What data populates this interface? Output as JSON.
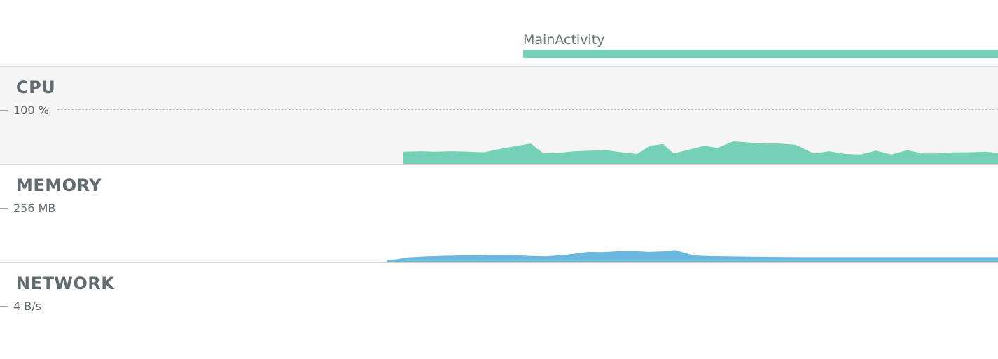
{
  "timeline": {
    "activity_label": "MainActivity",
    "activity_color": "#74d1b5"
  },
  "monitors": {
    "cpu": {
      "title": "CPU",
      "axis_max_label": "100 %",
      "color": "#74d1b5",
      "unit": "%",
      "samples": [
        [
          0.0,
          0
        ],
        [
          0.0,
          22
        ],
        [
          0.07,
          23
        ],
        [
          0.12,
          22
        ],
        [
          0.19,
          23
        ],
        [
          0.25,
          22
        ],
        [
          0.31,
          21
        ],
        [
          0.37,
          27
        ],
        [
          0.43,
          32
        ],
        [
          0.49,
          37
        ],
        [
          0.54,
          19
        ],
        [
          0.6,
          20
        ],
        [
          0.66,
          23
        ],
        [
          0.72,
          24
        ],
        [
          0.78,
          25
        ],
        [
          0.84,
          21
        ],
        [
          0.9,
          18
        ],
        [
          0.95,
          33
        ],
        [
          1.0,
          36
        ],
        [
          1.04,
          19
        ],
        [
          1.1,
          26
        ],
        [
          1.16,
          33
        ],
        [
          1.21,
          29
        ],
        [
          1.27,
          41
        ],
        [
          1.33,
          39
        ],
        [
          1.39,
          37
        ],
        [
          1.45,
          37
        ],
        [
          1.51,
          35
        ],
        [
          1.58,
          19
        ],
        [
          1.64,
          23
        ],
        [
          1.7,
          18
        ],
        [
          1.76,
          17
        ],
        [
          1.82,
          24
        ],
        [
          1.88,
          17
        ],
        [
          1.94,
          25
        ],
        [
          2.0,
          19
        ],
        [
          2.06,
          19
        ],
        [
          2.12,
          21
        ],
        [
          2.18,
          21
        ],
        [
          2.24,
          22
        ],
        [
          2.29,
          20
        ],
        [
          2.29,
          0
        ]
      ],
      "x_range": [
        0,
        2.29
      ],
      "y_range": [
        0,
        100
      ]
    },
    "memory": {
      "title": "MEMORY",
      "axis_max_label": "256 MB",
      "color": "#6bb8df",
      "unit": "MB",
      "samples": [
        [
          0.0,
          0
        ],
        [
          0.0,
          8
        ],
        [
          0.04,
          12
        ],
        [
          0.08,
          21
        ],
        [
          0.14,
          25
        ],
        [
          0.21,
          28
        ],
        [
          0.28,
          30
        ],
        [
          0.35,
          31
        ],
        [
          0.41,
          33
        ],
        [
          0.48,
          33
        ],
        [
          0.54,
          28
        ],
        [
          0.61,
          26
        ],
        [
          0.69,
          34
        ],
        [
          0.77,
          47
        ],
        [
          0.82,
          46
        ],
        [
          0.88,
          50
        ],
        [
          0.95,
          51
        ],
        [
          1.0,
          47
        ],
        [
          1.06,
          50
        ],
        [
          1.1,
          56
        ],
        [
          1.17,
          30
        ],
        [
          1.23,
          27
        ],
        [
          1.3,
          26
        ],
        [
          1.4,
          24
        ],
        [
          1.5,
          23
        ],
        [
          1.6,
          22
        ],
        [
          1.7,
          22
        ],
        [
          1.8,
          22
        ],
        [
          1.9,
          22
        ],
        [
          2.0,
          22
        ],
        [
          2.1,
          22
        ],
        [
          2.2,
          22
        ],
        [
          2.33,
          22
        ],
        [
          2.33,
          0
        ]
      ],
      "x_range": [
        0,
        2.33
      ],
      "y_range": [
        0,
        256
      ]
    },
    "network": {
      "title": "NETWORK",
      "axis_max_label": "4 B/s",
      "color": "#6bb8df",
      "unit": "B/s"
    }
  }
}
